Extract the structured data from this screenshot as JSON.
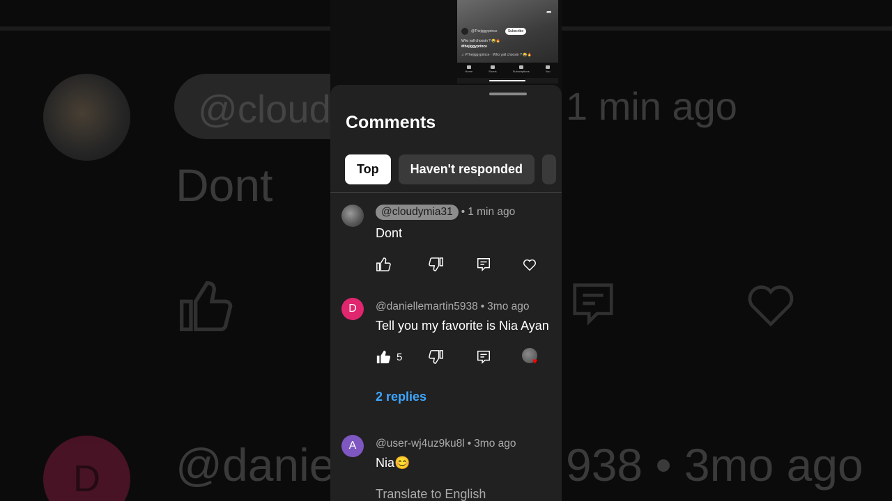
{
  "thumbnail": {
    "user": "@Thejiggyprince",
    "subscribe": "Subscribe",
    "caption": "Who yall choosin ? 😂🔥",
    "hashtag": "#thejiggyprince",
    "music": "♫ #Thejiggyprince · Who yall choosin ? 😂🔥",
    "share_label": "Share",
    "nav": [
      "Home",
      "Shorts",
      "Subscriptions",
      "You"
    ]
  },
  "sheet": {
    "title": "Comments",
    "chips": [
      "Top",
      "Haven't responded"
    ]
  },
  "comments": [
    {
      "handle": "@cloudymia31",
      "time": "1 min ago",
      "text": "Dont",
      "highlighted": true
    },
    {
      "avatar_letter": "D",
      "avatar_color": "#e0266e",
      "handle": "@daniellemartin5938",
      "time": "3mo ago",
      "text": "Tell you my favorite is Nia Ayan",
      "likes": "5",
      "replies": "2 replies"
    },
    {
      "avatar_letter": "A",
      "avatar_color": "#7e57c2",
      "handle": "@user-wj4uz9ku8l",
      "time": "3mo ago",
      "text": "Nia😊",
      "translate": "Translate to English"
    }
  ],
  "background": {
    "chip": "@cloud",
    "time": "1 min ago",
    "text": "Dont",
    "letter": "D",
    "user": "@danie",
    "user_tail": "938 • 3mo ago"
  },
  "colors": {
    "accent_link": "#3ea6ff",
    "sheet_bg": "#212121",
    "heart_red": "#ff0000"
  }
}
